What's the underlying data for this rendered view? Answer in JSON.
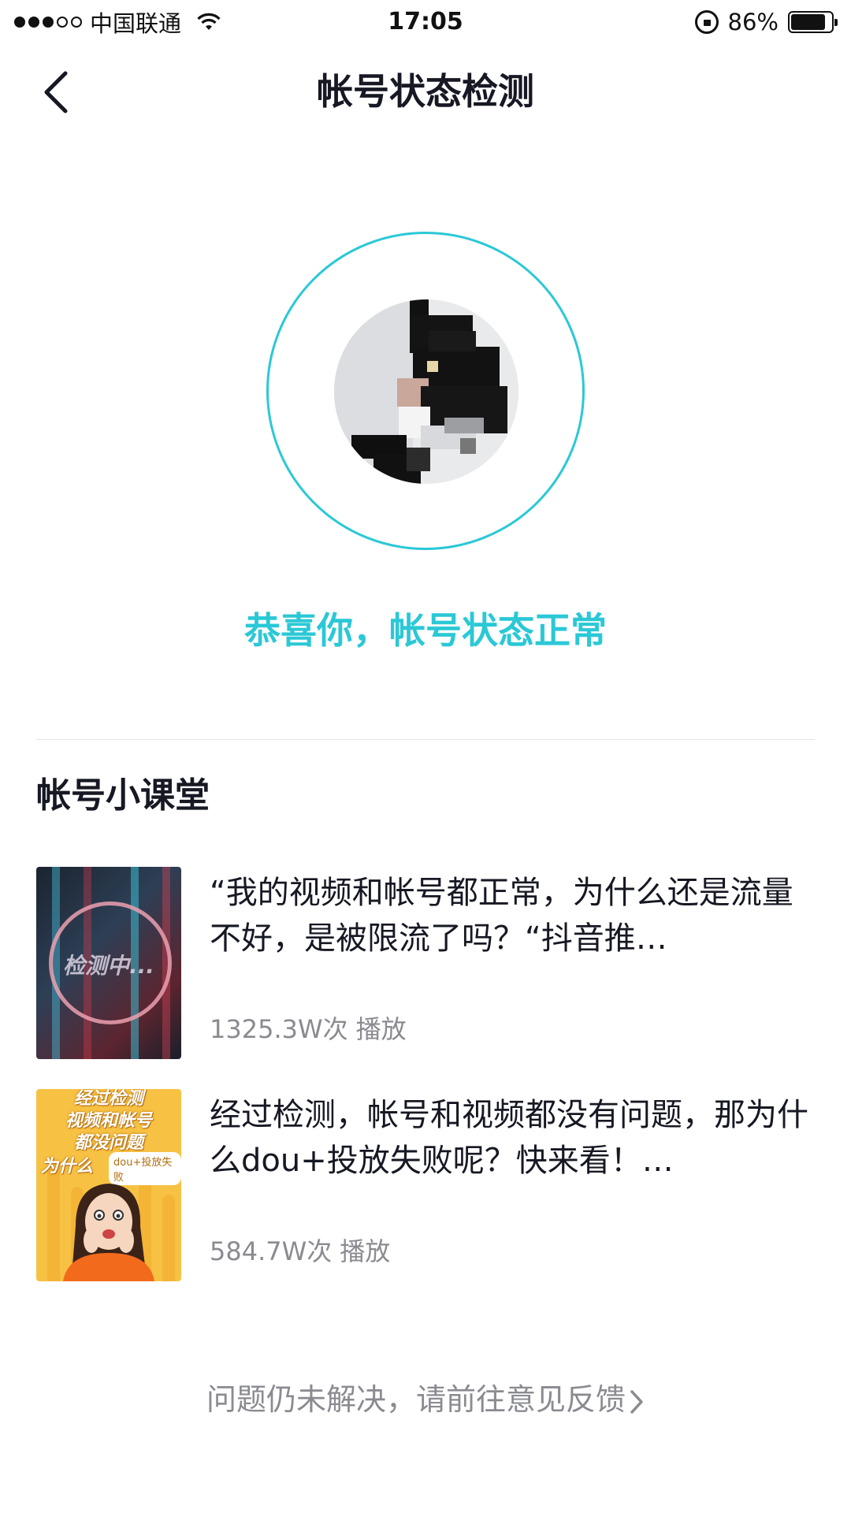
{
  "status_bar": {
    "carrier": "中国联通",
    "time": "17:05",
    "battery_percent": "86%",
    "battery_level": 0.86,
    "icons": [
      "signal-dots-icon",
      "wifi-icon",
      "rotation-lock-icon",
      "battery-icon"
    ]
  },
  "nav": {
    "title": "帐号状态检测",
    "back_icon": "chevron-left-icon"
  },
  "status": {
    "message": "恭喜你，帐号状态正常",
    "accent_color": "#2bc8d6"
  },
  "lessons": {
    "section_title": "帐号小课堂",
    "items": [
      {
        "title": "“我的视频和帐号都正常，为什么还是流量不好，是被限流了吗？“抖音推…",
        "views": "1325.3W次",
        "views_suffix": "播放",
        "thumb_text": "检测中..."
      },
      {
        "title": "经过检测，帐号和视频都没有问题，那为什么dou+投放失败呢？快来看！…",
        "views": "584.7W次",
        "views_suffix": "播放",
        "thumb_lines": [
          "经过检测",
          "视频和帐号",
          "都没问题",
          "为什么"
        ],
        "thumb_tag": "dou+投放失败"
      }
    ]
  },
  "feedback": {
    "label": "问题仍未解决，请前往意见反馈"
  }
}
